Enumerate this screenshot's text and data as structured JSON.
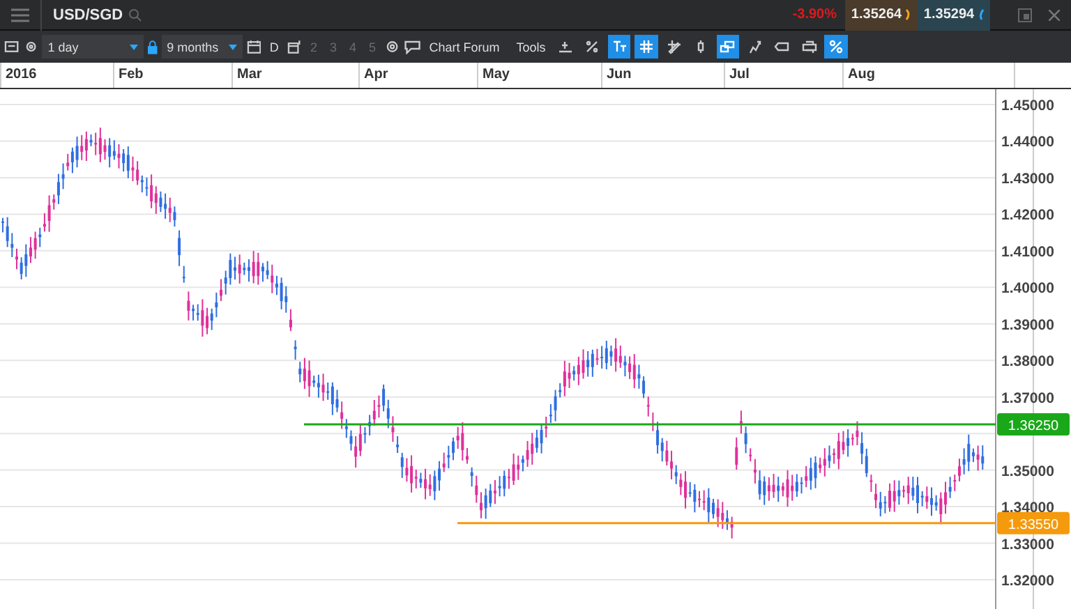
{
  "header": {
    "symbol": "USD/SGD",
    "change": "-3.90%",
    "sell": "1.35264",
    "buy": "1.35294"
  },
  "toolbar": {
    "interval": "1 day",
    "period": "9 months",
    "day_button": "D",
    "presets": [
      {
        "label": "2",
        "disabled": true
      },
      {
        "label": "3",
        "disabled": true
      },
      {
        "label": "4",
        "disabled": true
      },
      {
        "label": "5",
        "disabled": true
      }
    ],
    "forum": "Chart Forum",
    "tools_label": "Tools",
    "tools": [
      {
        "kind": "line",
        "selected": false
      },
      {
        "kind": "percent",
        "selected": false
      },
      {
        "kind": "text",
        "selected": true
      },
      {
        "kind": "grid",
        "selected": true
      },
      {
        "kind": "pencil",
        "selected": false
      },
      {
        "kind": "candle",
        "selected": false
      },
      {
        "kind": "windows",
        "selected": true
      },
      {
        "kind": "figure",
        "selected": false
      },
      {
        "kind": "tag",
        "selected": false
      },
      {
        "kind": "print",
        "selected": false
      },
      {
        "kind": "settings",
        "selected": true
      }
    ]
  },
  "chart": {
    "months": [
      "2016",
      "Feb",
      "Mar",
      "Apr",
      "May",
      "Jun",
      "Jul",
      "Aug"
    ],
    "yticks": [
      "1.45000",
      "1.44000",
      "1.43000",
      "1.42000",
      "1.41000",
      "1.40000",
      "1.39000",
      "1.38000",
      "1.37000",
      "1.35000",
      "1.34000",
      "1.33000",
      "1.32000"
    ],
    "levels": [
      {
        "label": "1.36250",
        "color": "#1aa81a"
      },
      {
        "label": "1.33550",
        "color": "#f59a0c"
      }
    ]
  }
}
